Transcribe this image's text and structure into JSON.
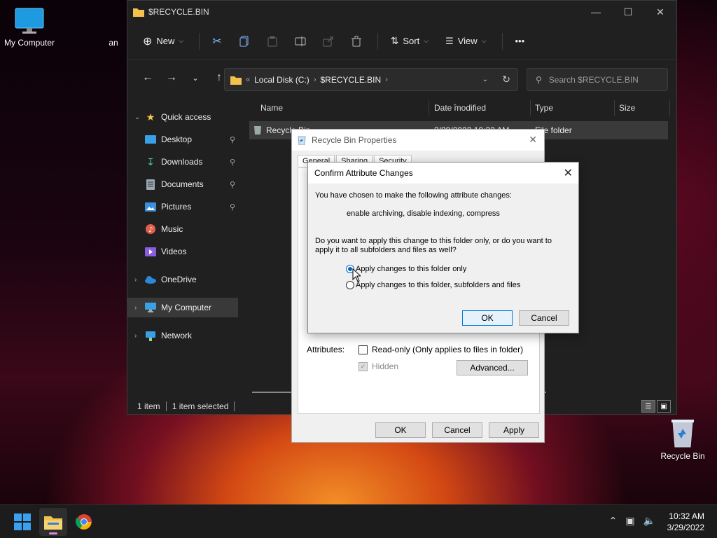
{
  "desktop": {
    "icons": [
      {
        "label": "My Computer"
      },
      {
        "label": "an"
      },
      {
        "label": "Recycle Bin"
      }
    ]
  },
  "explorer": {
    "title": "$RECYCLE.BIN",
    "toolbar": {
      "new_label": "New",
      "sort_label": "Sort",
      "view_label": "View",
      "more_label": "•••"
    },
    "address": {
      "crumbs": [
        "Local Disk (C:)",
        "$RECYCLE.BIN"
      ],
      "overflow": "«"
    },
    "search_placeholder": "Search $RECYCLE.BIN",
    "sidebar": [
      {
        "label": "Quick access"
      },
      {
        "label": "Desktop"
      },
      {
        "label": "Downloads"
      },
      {
        "label": "Documents"
      },
      {
        "label": "Pictures"
      },
      {
        "label": "Music"
      },
      {
        "label": "Videos"
      },
      {
        "label": "OneDrive"
      },
      {
        "label": "My Computer"
      },
      {
        "label": "Network"
      }
    ],
    "columns": [
      "Name",
      "Date modified",
      "Type",
      "Size"
    ],
    "files": [
      {
        "name": "Recycle Bin",
        "date": "3/29/2022 10:32 AM",
        "type": "File folder",
        "size": ""
      }
    ],
    "status": {
      "count": "1 item",
      "selected": "1 item selected"
    }
  },
  "properties": {
    "title": "Recycle Bin Properties",
    "tabs": [
      "General",
      "Sharing",
      "Security"
    ],
    "attributes_label": "Attributes:",
    "readonly_label": "Read-only (Only applies to files in folder)",
    "hidden_label": "Hidden",
    "advanced_label": "Advanced...",
    "ok_label": "OK",
    "cancel_label": "Cancel",
    "apply_label": "Apply"
  },
  "confirm": {
    "title": "Confirm Attribute Changes",
    "intro": "You have chosen to make the following attribute changes:",
    "changes": "enable archiving, disable indexing, compress",
    "question_line1": "Do you want to apply this change to this folder only, or do you want to",
    "question_line2": "apply it to all subfolders and files as well?",
    "option_folder_only": "Apply changes to this folder only",
    "option_all": "Apply changes to this folder, subfolders and files",
    "selected_option": "folder_only",
    "ok_label": "OK",
    "cancel_label": "Cancel"
  },
  "taskbar": {
    "time": "10:32 AM",
    "date": "3/29/2022"
  },
  "colors": {
    "accent": "#0067c0",
    "explorer_bg": "#202020",
    "folder_yellow": "#f2c14e"
  }
}
